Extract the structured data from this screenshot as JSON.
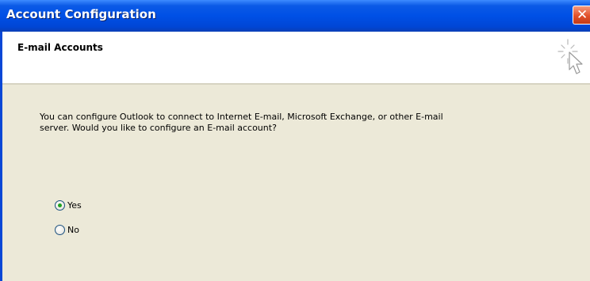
{
  "window": {
    "title": "Account Configuration",
    "close_symbol": "✕"
  },
  "header": {
    "title": "E-mail Accounts",
    "icon": "wizard-cursor-icon"
  },
  "main": {
    "prompt": "You can configure Outlook to connect to Internet E-mail, Microsoft Exchange, or other E-mail server. Would you like to configure an E-mail account?",
    "options": [
      {
        "label": "Yes",
        "checked": true
      },
      {
        "label": "No",
        "checked": false
      }
    ]
  },
  "colors": {
    "titlebar": "#0050e6",
    "dialog_bg": "#ece9d8",
    "header_bg": "#ffffff",
    "close_button": "#e2502a",
    "radio_dot": "#21a121"
  }
}
